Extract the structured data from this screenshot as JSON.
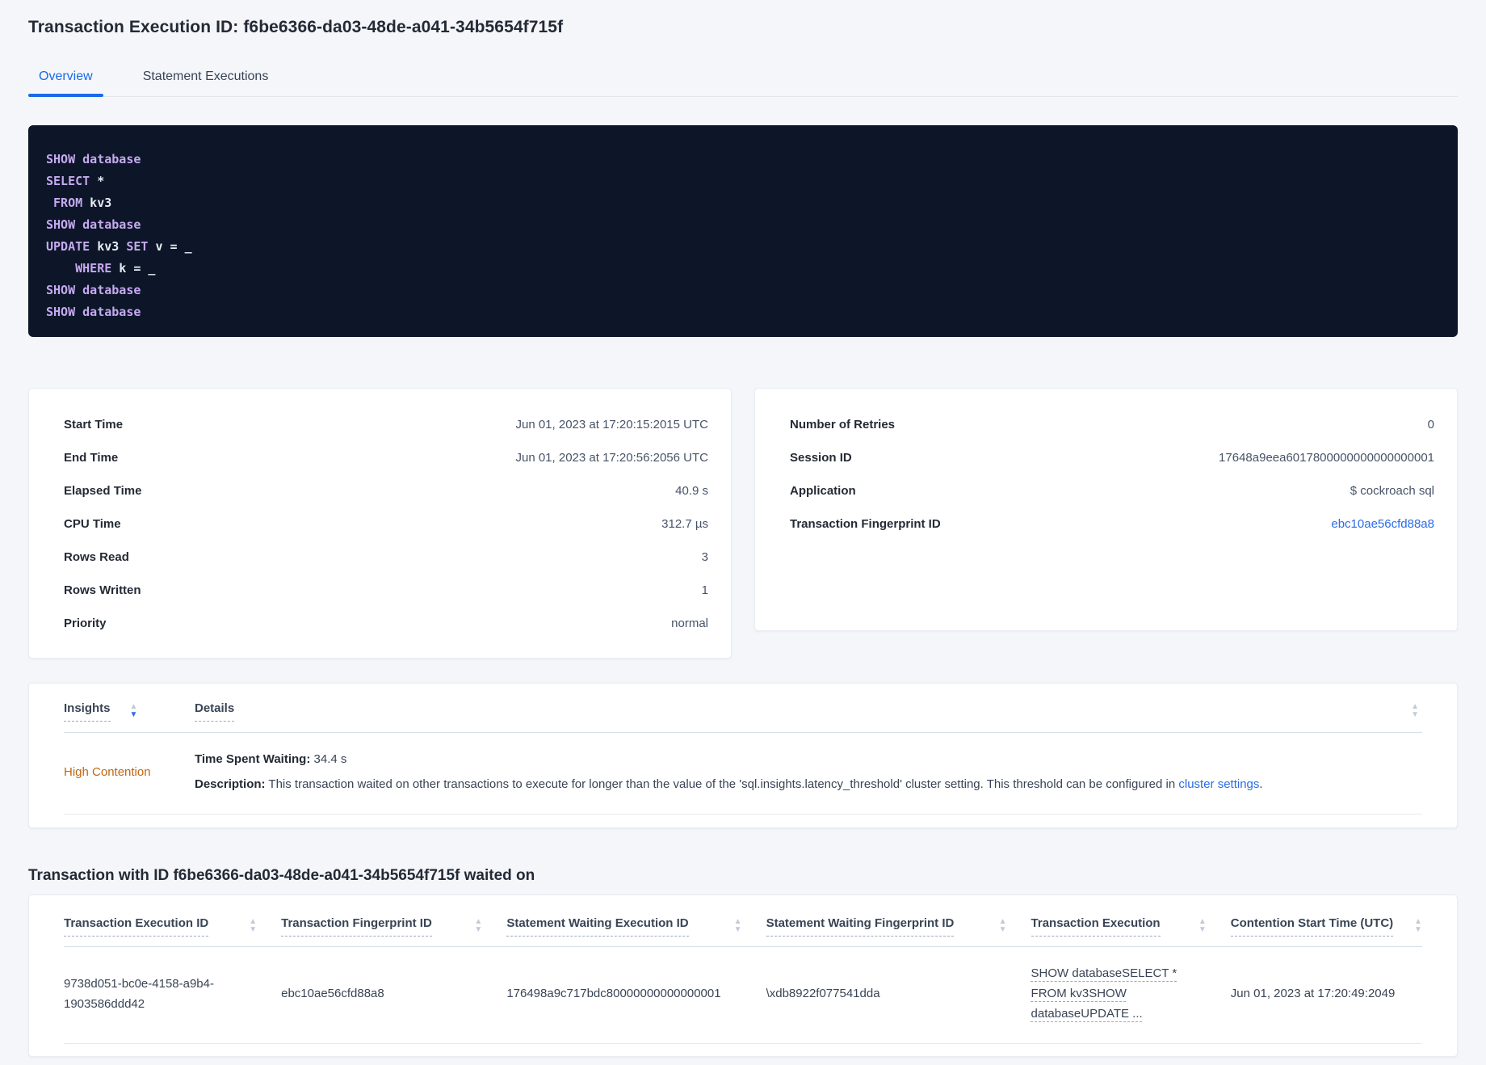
{
  "colors": {
    "accent_blue": "#1a6ae6",
    "link_blue": "#2a6ce8",
    "insight_orange": "#c2660e",
    "code_background": "#0c1628",
    "code_keyword": "#c6a9f0",
    "code_text": "#e7ecf3"
  },
  "icons": {
    "sort_asc": "▲",
    "sort_desc": "▼"
  },
  "header": {
    "title": "Transaction Execution ID: f6be6366-da03-48de-a041-34b5654f715f"
  },
  "tabs": [
    {
      "label": "Overview",
      "active": true
    },
    {
      "label": "Statement Executions",
      "active": false
    }
  ],
  "sql": {
    "lines": [
      [
        [
          "SHOW",
          "kw"
        ],
        [
          " database",
          "kw"
        ]
      ],
      [
        [
          "SELECT",
          "kw"
        ],
        [
          " *",
          "id"
        ]
      ],
      [
        [
          " FROM",
          "kw"
        ],
        [
          " kv3",
          "id"
        ]
      ],
      [
        [
          "SHOW",
          "kw"
        ],
        [
          " database",
          "kw"
        ]
      ],
      [
        [
          "UPDATE",
          "kw"
        ],
        [
          " kv3 ",
          "id"
        ],
        [
          "SET",
          "kw"
        ],
        [
          " v = _",
          "id"
        ]
      ],
      [
        [
          "    WHERE",
          "kw"
        ],
        [
          " k = _",
          "id"
        ]
      ],
      [
        [
          "SHOW",
          "kw"
        ],
        [
          " database",
          "kw"
        ]
      ],
      [
        [
          "SHOW",
          "kw"
        ],
        [
          " database",
          "kw"
        ]
      ]
    ]
  },
  "cards": {
    "left": {
      "rows": [
        {
          "label": "Start Time",
          "value": "Jun 01, 2023 at 17:20:15:2015 UTC"
        },
        {
          "label": "End Time",
          "value": "Jun 01, 2023 at 17:20:56:2056 UTC"
        },
        {
          "label": "Elapsed Time",
          "value": "40.9 s"
        },
        {
          "label": "CPU Time",
          "value": "312.7 µs"
        },
        {
          "label": "Rows Read",
          "value": "3"
        },
        {
          "label": "Rows Written",
          "value": "1"
        },
        {
          "label": "Priority",
          "value": "normal"
        }
      ]
    },
    "right": {
      "rows": [
        {
          "label": "Number of Retries",
          "value": "0"
        },
        {
          "label": "Session ID",
          "value": "17648a9eea6017800000000000000001"
        },
        {
          "label": "Application",
          "value": "$ cockroach sql"
        },
        {
          "label": "Transaction Fingerprint ID",
          "value": "ebc10ae56cfd88a8"
        }
      ]
    }
  },
  "insights": {
    "columns": [
      {
        "label": "Insights"
      },
      {
        "label": "Details"
      }
    ],
    "row": {
      "insight": "High Contention",
      "waiting_label": "Time Spent Waiting:",
      "waiting_value": " 34.4 s",
      "description_label": "Description:",
      "description_text": " This transaction waited on other transactions to execute for longer than the value of the 'sql.insights.latency_threshold' cluster setting. This threshold can be configured in ",
      "description_link": "cluster settings",
      "description_suffix": "."
    }
  },
  "waited_on": {
    "heading": "Transaction with ID f6be6366-da03-48de-a041-34b5654f715f waited on",
    "columns": [
      {
        "label": "Transaction Execution ID"
      },
      {
        "label": "Transaction Fingerprint ID"
      },
      {
        "label": "Statement Waiting Execution ID"
      },
      {
        "label": "Statement Waiting Fingerprint ID"
      },
      {
        "label": "Transaction Execution"
      },
      {
        "label": "Contention Start Time (UTC)"
      }
    ],
    "row": {
      "transaction_execution_id": "9738d051-bc0e-4158-a9b4-1903586ddd42",
      "transaction_fingerprint_id": "ebc10ae56cfd88a8",
      "statement_waiting_execution_id": "176498a9c717bdc80000000000000001",
      "statement_waiting_fingerprint_id": "\\xdb8922f077541dda",
      "transaction_execution": "SHOW databaseSELECT * FROM kv3SHOW databaseUPDATE ...",
      "contention_start_time": "Jun 01, 2023 at 17:20:49:2049"
    }
  }
}
